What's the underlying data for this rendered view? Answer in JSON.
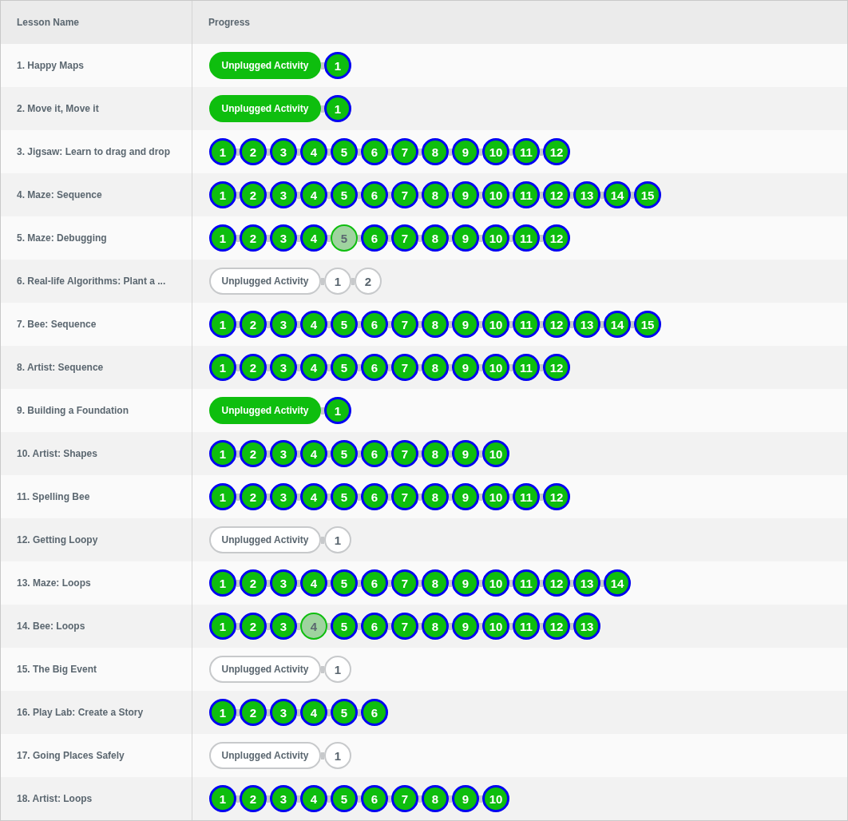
{
  "table": {
    "columns": [
      "Lesson Name",
      "Progress"
    ],
    "rows": [
      {
        "name": "1. Happy Maps",
        "items": [
          {
            "kind": "unplugged",
            "label": "Unplugged Activity",
            "completed": true,
            "attempted": true
          },
          {
            "kind": "level",
            "label": "1",
            "completed": true,
            "attempted": true
          }
        ]
      },
      {
        "name": "2. Move it, Move it",
        "items": [
          {
            "kind": "unplugged",
            "label": "Unplugged Activity",
            "completed": true,
            "attempted": true
          },
          {
            "kind": "level",
            "label": "1",
            "completed": true,
            "attempted": true
          }
        ]
      },
      {
        "name": "3. Jigsaw: Learn to drag and drop",
        "items": [
          {
            "kind": "level",
            "label": "1",
            "completed": true,
            "attempted": true
          },
          {
            "kind": "level",
            "label": "2",
            "completed": true,
            "attempted": true
          },
          {
            "kind": "level",
            "label": "3",
            "completed": true,
            "attempted": true
          },
          {
            "kind": "level",
            "label": "4",
            "completed": true,
            "attempted": true
          },
          {
            "kind": "level",
            "label": "5",
            "completed": true,
            "attempted": true
          },
          {
            "kind": "level",
            "label": "6",
            "completed": true,
            "attempted": true
          },
          {
            "kind": "level",
            "label": "7",
            "completed": true,
            "attempted": true
          },
          {
            "kind": "level",
            "label": "8",
            "completed": true,
            "attempted": true
          },
          {
            "kind": "level",
            "label": "9",
            "completed": true,
            "attempted": true
          },
          {
            "kind": "level",
            "label": "10",
            "completed": true,
            "attempted": true
          },
          {
            "kind": "level",
            "label": "11",
            "completed": true,
            "attempted": true
          },
          {
            "kind": "level",
            "label": "12",
            "completed": true,
            "attempted": true
          }
        ]
      },
      {
        "name": "4. Maze: Sequence",
        "items": [
          {
            "kind": "level",
            "label": "1",
            "completed": true,
            "attempted": true
          },
          {
            "kind": "level",
            "label": "2",
            "completed": true,
            "attempted": true
          },
          {
            "kind": "level",
            "label": "3",
            "completed": true,
            "attempted": true
          },
          {
            "kind": "level",
            "label": "4",
            "completed": true,
            "attempted": true
          },
          {
            "kind": "level",
            "label": "5",
            "completed": true,
            "attempted": true
          },
          {
            "kind": "level",
            "label": "6",
            "completed": true,
            "attempted": true
          },
          {
            "kind": "level",
            "label": "7",
            "completed": true,
            "attempted": true
          },
          {
            "kind": "level",
            "label": "8",
            "completed": true,
            "attempted": true
          },
          {
            "kind": "level",
            "label": "9",
            "completed": true,
            "attempted": true
          },
          {
            "kind": "level",
            "label": "10",
            "completed": true,
            "attempted": true
          },
          {
            "kind": "level",
            "label": "11",
            "completed": true,
            "attempted": true
          },
          {
            "kind": "level",
            "label": "12",
            "completed": true,
            "attempted": true
          },
          {
            "kind": "level",
            "label": "13",
            "completed": true,
            "attempted": true
          },
          {
            "kind": "level",
            "label": "14",
            "completed": true,
            "attempted": true
          },
          {
            "kind": "level",
            "label": "15",
            "completed": true,
            "attempted": true
          }
        ]
      },
      {
        "name": "5. Maze: Debugging",
        "items": [
          {
            "kind": "level",
            "label": "1",
            "completed": true,
            "attempted": true
          },
          {
            "kind": "level",
            "label": "2",
            "completed": true,
            "attempted": true
          },
          {
            "kind": "level",
            "label": "3",
            "completed": true,
            "attempted": true
          },
          {
            "kind": "level",
            "label": "4",
            "completed": true,
            "attempted": true
          },
          {
            "kind": "level",
            "label": "5",
            "completed": false,
            "attempted": true
          },
          {
            "kind": "level",
            "label": "6",
            "completed": true,
            "attempted": true
          },
          {
            "kind": "level",
            "label": "7",
            "completed": true,
            "attempted": true
          },
          {
            "kind": "level",
            "label": "8",
            "completed": true,
            "attempted": true
          },
          {
            "kind": "level",
            "label": "9",
            "completed": true,
            "attempted": true
          },
          {
            "kind": "level",
            "label": "10",
            "completed": true,
            "attempted": true
          },
          {
            "kind": "level",
            "label": "11",
            "completed": true,
            "attempted": true
          },
          {
            "kind": "level",
            "label": "12",
            "completed": true,
            "attempted": true
          }
        ]
      },
      {
        "name": "6. Real-life Algorithms: Plant a ...",
        "items": [
          {
            "kind": "unplugged",
            "label": "Unplugged Activity",
            "completed": false,
            "attempted": false
          },
          {
            "kind": "level",
            "label": "1",
            "completed": false,
            "attempted": false
          },
          {
            "kind": "level",
            "label": "2",
            "completed": false,
            "attempted": false
          }
        ]
      },
      {
        "name": "7. Bee: Sequence",
        "items": [
          {
            "kind": "level",
            "label": "1",
            "completed": true,
            "attempted": true
          },
          {
            "kind": "level",
            "label": "2",
            "completed": true,
            "attempted": true
          },
          {
            "kind": "level",
            "label": "3",
            "completed": true,
            "attempted": true
          },
          {
            "kind": "level",
            "label": "4",
            "completed": true,
            "attempted": true
          },
          {
            "kind": "level",
            "label": "5",
            "completed": true,
            "attempted": true
          },
          {
            "kind": "level",
            "label": "6",
            "completed": true,
            "attempted": true
          },
          {
            "kind": "level",
            "label": "7",
            "completed": true,
            "attempted": true
          },
          {
            "kind": "level",
            "label": "8",
            "completed": true,
            "attempted": true
          },
          {
            "kind": "level",
            "label": "9",
            "completed": true,
            "attempted": true
          },
          {
            "kind": "level",
            "label": "10",
            "completed": true,
            "attempted": true
          },
          {
            "kind": "level",
            "label": "11",
            "completed": true,
            "attempted": true
          },
          {
            "kind": "level",
            "label": "12",
            "completed": true,
            "attempted": true
          },
          {
            "kind": "level",
            "label": "13",
            "completed": true,
            "attempted": true
          },
          {
            "kind": "level",
            "label": "14",
            "completed": true,
            "attempted": true
          },
          {
            "kind": "level",
            "label": "15",
            "completed": true,
            "attempted": true
          }
        ]
      },
      {
        "name": "8. Artist: Sequence",
        "items": [
          {
            "kind": "level",
            "label": "1",
            "completed": true,
            "attempted": true
          },
          {
            "kind": "level",
            "label": "2",
            "completed": true,
            "attempted": true
          },
          {
            "kind": "level",
            "label": "3",
            "completed": true,
            "attempted": true
          },
          {
            "kind": "level",
            "label": "4",
            "completed": true,
            "attempted": true
          },
          {
            "kind": "level",
            "label": "5",
            "completed": true,
            "attempted": true
          },
          {
            "kind": "level",
            "label": "6",
            "completed": true,
            "attempted": true
          },
          {
            "kind": "level",
            "label": "7",
            "completed": true,
            "attempted": true
          },
          {
            "kind": "level",
            "label": "8",
            "completed": true,
            "attempted": true
          },
          {
            "kind": "level",
            "label": "9",
            "completed": true,
            "attempted": true
          },
          {
            "kind": "level",
            "label": "10",
            "completed": true,
            "attempted": true
          },
          {
            "kind": "level",
            "label": "11",
            "completed": true,
            "attempted": true
          },
          {
            "kind": "level",
            "label": "12",
            "completed": true,
            "attempted": true
          }
        ]
      },
      {
        "name": "9. Building a Foundation",
        "items": [
          {
            "kind": "unplugged",
            "label": "Unplugged Activity",
            "completed": true,
            "attempted": true
          },
          {
            "kind": "level",
            "label": "1",
            "completed": true,
            "attempted": true
          }
        ]
      },
      {
        "name": "10. Artist: Shapes",
        "items": [
          {
            "kind": "level",
            "label": "1",
            "completed": true,
            "attempted": true
          },
          {
            "kind": "level",
            "label": "2",
            "completed": true,
            "attempted": true
          },
          {
            "kind": "level",
            "label": "3",
            "completed": true,
            "attempted": true
          },
          {
            "kind": "level",
            "label": "4",
            "completed": true,
            "attempted": true
          },
          {
            "kind": "level",
            "label": "5",
            "completed": true,
            "attempted": true
          },
          {
            "kind": "level",
            "label": "6",
            "completed": true,
            "attempted": true
          },
          {
            "kind": "level",
            "label": "7",
            "completed": true,
            "attempted": true
          },
          {
            "kind": "level",
            "label": "8",
            "completed": true,
            "attempted": true
          },
          {
            "kind": "level",
            "label": "9",
            "completed": true,
            "attempted": true
          },
          {
            "kind": "level",
            "label": "10",
            "completed": true,
            "attempted": true
          }
        ]
      },
      {
        "name": "11. Spelling Bee",
        "items": [
          {
            "kind": "level",
            "label": "1",
            "completed": true,
            "attempted": true
          },
          {
            "kind": "level",
            "label": "2",
            "completed": true,
            "attempted": true
          },
          {
            "kind": "level",
            "label": "3",
            "completed": true,
            "attempted": true
          },
          {
            "kind": "level",
            "label": "4",
            "completed": true,
            "attempted": true
          },
          {
            "kind": "level",
            "label": "5",
            "completed": true,
            "attempted": true
          },
          {
            "kind": "level",
            "label": "6",
            "completed": true,
            "attempted": true
          },
          {
            "kind": "level",
            "label": "7",
            "completed": true,
            "attempted": true
          },
          {
            "kind": "level",
            "label": "8",
            "completed": true,
            "attempted": true
          },
          {
            "kind": "level",
            "label": "9",
            "completed": true,
            "attempted": true
          },
          {
            "kind": "level",
            "label": "10",
            "completed": true,
            "attempted": true
          },
          {
            "kind": "level",
            "label": "11",
            "completed": true,
            "attempted": true
          },
          {
            "kind": "level",
            "label": "12",
            "completed": true,
            "attempted": true
          }
        ]
      },
      {
        "name": "12. Getting Loopy",
        "items": [
          {
            "kind": "unplugged",
            "label": "Unplugged Activity",
            "completed": false,
            "attempted": false
          },
          {
            "kind": "level",
            "label": "1",
            "completed": false,
            "attempted": false
          }
        ]
      },
      {
        "name": "13. Maze: Loops",
        "items": [
          {
            "kind": "level",
            "label": "1",
            "completed": true,
            "attempted": true
          },
          {
            "kind": "level",
            "label": "2",
            "completed": true,
            "attempted": true
          },
          {
            "kind": "level",
            "label": "3",
            "completed": true,
            "attempted": true
          },
          {
            "kind": "level",
            "label": "4",
            "completed": true,
            "attempted": true
          },
          {
            "kind": "level",
            "label": "5",
            "completed": true,
            "attempted": true
          },
          {
            "kind": "level",
            "label": "6",
            "completed": true,
            "attempted": true
          },
          {
            "kind": "level",
            "label": "7",
            "completed": true,
            "attempted": true
          },
          {
            "kind": "level",
            "label": "8",
            "completed": true,
            "attempted": true
          },
          {
            "kind": "level",
            "label": "9",
            "completed": true,
            "attempted": true
          },
          {
            "kind": "level",
            "label": "10",
            "completed": true,
            "attempted": true
          },
          {
            "kind": "level",
            "label": "11",
            "completed": true,
            "attempted": true
          },
          {
            "kind": "level",
            "label": "12",
            "completed": true,
            "attempted": true
          },
          {
            "kind": "level",
            "label": "13",
            "completed": true,
            "attempted": true
          },
          {
            "kind": "level",
            "label": "14",
            "completed": true,
            "attempted": true
          }
        ]
      },
      {
        "name": "14. Bee: Loops",
        "items": [
          {
            "kind": "level",
            "label": "1",
            "completed": true,
            "attempted": true
          },
          {
            "kind": "level",
            "label": "2",
            "completed": true,
            "attempted": true
          },
          {
            "kind": "level",
            "label": "3",
            "completed": true,
            "attempted": true
          },
          {
            "kind": "level",
            "label": "4",
            "completed": false,
            "attempted": true
          },
          {
            "kind": "level",
            "label": "5",
            "completed": true,
            "attempted": true
          },
          {
            "kind": "level",
            "label": "6",
            "completed": true,
            "attempted": true
          },
          {
            "kind": "level",
            "label": "7",
            "completed": true,
            "attempted": true
          },
          {
            "kind": "level",
            "label": "8",
            "completed": true,
            "attempted": true
          },
          {
            "kind": "level",
            "label": "9",
            "completed": true,
            "attempted": true
          },
          {
            "kind": "level",
            "label": "10",
            "completed": true,
            "attempted": true
          },
          {
            "kind": "level",
            "label": "11",
            "completed": true,
            "attempted": true
          },
          {
            "kind": "level",
            "label": "12",
            "completed": true,
            "attempted": true
          },
          {
            "kind": "level",
            "label": "13",
            "completed": true,
            "attempted": true
          }
        ]
      },
      {
        "name": "15. The Big Event",
        "items": [
          {
            "kind": "unplugged",
            "label": "Unplugged Activity",
            "completed": false,
            "attempted": false
          },
          {
            "kind": "level",
            "label": "1",
            "completed": false,
            "attempted": false
          }
        ]
      },
      {
        "name": "16. Play Lab: Create a Story",
        "items": [
          {
            "kind": "level",
            "label": "1",
            "completed": true,
            "attempted": true
          },
          {
            "kind": "level",
            "label": "2",
            "completed": true,
            "attempted": true
          },
          {
            "kind": "level",
            "label": "3",
            "completed": true,
            "attempted": true
          },
          {
            "kind": "level",
            "label": "4",
            "completed": true,
            "attempted": true
          },
          {
            "kind": "level",
            "label": "5",
            "completed": true,
            "attempted": true
          },
          {
            "kind": "level",
            "label": "6",
            "completed": true,
            "attempted": true
          }
        ]
      },
      {
        "name": "17. Going Places Safely",
        "items": [
          {
            "kind": "unplugged",
            "label": "Unplugged Activity",
            "completed": false,
            "attempted": false
          },
          {
            "kind": "level",
            "label": "1",
            "completed": false,
            "attempted": false
          }
        ]
      },
      {
        "name": "18. Artist: Loops",
        "items": [
          {
            "kind": "level",
            "label": "1",
            "completed": true,
            "attempted": true
          },
          {
            "kind": "level",
            "label": "2",
            "completed": true,
            "attempted": true
          },
          {
            "kind": "level",
            "label": "3",
            "completed": true,
            "attempted": true
          },
          {
            "kind": "level",
            "label": "4",
            "completed": true,
            "attempted": true
          },
          {
            "kind": "level",
            "label": "5",
            "completed": true,
            "attempted": true
          },
          {
            "kind": "level",
            "label": "6",
            "completed": true,
            "attempted": true
          },
          {
            "kind": "level",
            "label": "7",
            "completed": true,
            "attempted": true
          },
          {
            "kind": "level",
            "label": "8",
            "completed": true,
            "attempted": true
          },
          {
            "kind": "level",
            "label": "9",
            "completed": true,
            "attempted": true
          },
          {
            "kind": "level",
            "label": "10",
            "completed": true,
            "attempted": true
          }
        ]
      }
    ]
  }
}
